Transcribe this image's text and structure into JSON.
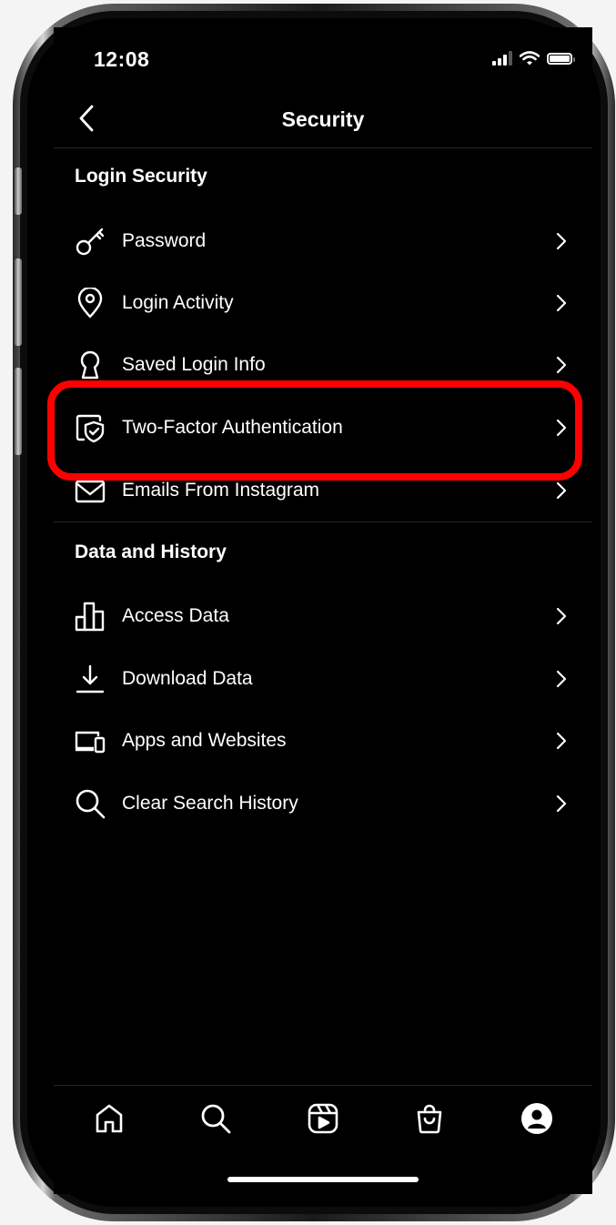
{
  "status": {
    "time": "12:08"
  },
  "header": {
    "title": "Security",
    "back_icon": "chevron-left-icon"
  },
  "sections": [
    {
      "title": "Login Security",
      "items": [
        {
          "label": "Password",
          "icon": "key-icon"
        },
        {
          "label": "Login Activity",
          "icon": "location-pin-icon"
        },
        {
          "label": "Saved Login Info",
          "icon": "keyhole-icon"
        },
        {
          "label": "Two-Factor Authentication",
          "icon": "shield-check-icon",
          "highlighted": true
        },
        {
          "label": "Emails From Instagram",
          "icon": "envelope-icon"
        }
      ]
    },
    {
      "title": "Data and History",
      "items": [
        {
          "label": "Access Data",
          "icon": "bar-chart-icon"
        },
        {
          "label": "Download Data",
          "icon": "download-icon"
        },
        {
          "label": "Apps and Websites",
          "icon": "devices-icon"
        },
        {
          "label": "Clear Search History",
          "icon": "search-icon"
        }
      ]
    }
  ],
  "tabbar": {
    "items": [
      {
        "name": "home",
        "icon": "home-icon"
      },
      {
        "name": "search",
        "icon": "search-icon"
      },
      {
        "name": "reels",
        "icon": "reels-icon"
      },
      {
        "name": "shop",
        "icon": "shopping-bag-icon"
      },
      {
        "name": "profile",
        "icon": "profile-icon",
        "active": true
      }
    ]
  },
  "colors": {
    "background": "#000000",
    "text": "#ffffff",
    "highlight": "#ff0000",
    "divider": "#262626"
  }
}
